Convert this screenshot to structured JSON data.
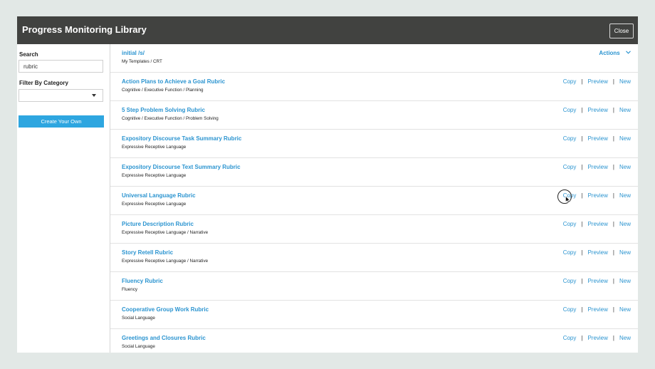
{
  "modal": {
    "title": "Progress Monitoring Library",
    "close_label": "Close"
  },
  "sidebar": {
    "search_label": "Search",
    "search_value": "rubric",
    "filter_label": "Filter By Category",
    "filter_value": "",
    "create_label": "Create Your Own"
  },
  "action_labels": {
    "copy": "Copy",
    "preview": "Preview",
    "new": "New",
    "sep": "|",
    "menu": "Actions"
  },
  "items": [
    {
      "name": "initial /s/",
      "category": "My Templates / CRT"
    },
    {
      "name": "Action Plans to Achieve a Goal Rubric",
      "category": "Cognitive / Executive Function / Planning"
    },
    {
      "name": "5 Step Problem Solving Rubric",
      "category": "Cognitive / Executive Function / Problem Solving"
    },
    {
      "name": "Expository Discourse Task Summary Rubric",
      "category": "Expressive Receptive Language"
    },
    {
      "name": "Expository Discourse Text Summary Rubric",
      "category": "Expressive Receptive Language"
    },
    {
      "name": "Universal Language Rubric",
      "category": "Expressive Receptive Language"
    },
    {
      "name": "Picture Description Rubric",
      "category": "Expressive Receptive Language / Narrative"
    },
    {
      "name": "Story Retell Rubric",
      "category": "Expressive Receptive Language / Narrative"
    },
    {
      "name": "Fluency Rubric",
      "category": "Fluency"
    },
    {
      "name": "Cooperative Group Work Rubric",
      "category": "Social Language"
    },
    {
      "name": "Greetings and Closures Rubric",
      "category": "Social Language"
    }
  ],
  "colors": {
    "header": "#414240",
    "link": "#2b94d0",
    "button": "#2ea6e0",
    "backdrop": "#e2e8e6"
  },
  "icons": {
    "dropdown": "caret-down-icon",
    "actions": "chevron-down-icon",
    "pointer": "mouse-pointer-icon"
  }
}
